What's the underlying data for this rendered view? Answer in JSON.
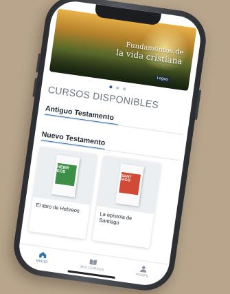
{
  "banner": {
    "title_line1": "Fundamentos de",
    "title_line2": "la vida cristiana",
    "logo_text": "Logos"
  },
  "carousel": {
    "pages": 3,
    "active_index": 0
  },
  "section": {
    "heading": "CURSOS DISPONIBLES"
  },
  "categories": [
    {
      "title": "Antiguo Testamento"
    },
    {
      "title": "Nuevo Testamento"
    }
  ],
  "courses": [
    {
      "cover_word": "HEBREOS",
      "cover_color": "#3d8f47",
      "label": "El libro de Hebreos"
    },
    {
      "cover_word": "SANTIAGO",
      "cover_color": "#d04a36",
      "label": "La epístola de Santiago"
    }
  ],
  "tabbar": {
    "items": [
      {
        "label": "INICIO",
        "icon": "home-icon",
        "active": true
      },
      {
        "label": "MIS CURSOS",
        "icon": "book-icon",
        "active": false
      },
      {
        "label": "PERFIL",
        "icon": "user-icon",
        "active": false
      }
    ]
  },
  "colors": {
    "background": "#b8a58c",
    "accent": "#2f6fa8",
    "heading": "#6c7580"
  }
}
